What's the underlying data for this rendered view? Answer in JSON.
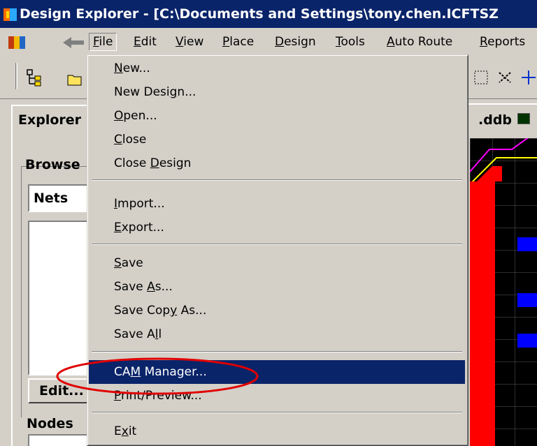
{
  "window": {
    "title": "Design Explorer - [C:\\Documents and Settings\\tony.chen.ICFTSZ"
  },
  "menubar": {
    "items": [
      {
        "pre": "",
        "ul": "F",
        "post": "ile"
      },
      {
        "pre": "",
        "ul": "E",
        "post": "dit"
      },
      {
        "pre": "",
        "ul": "V",
        "post": "iew"
      },
      {
        "pre": "",
        "ul": "P",
        "post": "lace"
      },
      {
        "pre": "",
        "ul": "D",
        "post": "esign"
      },
      {
        "pre": "",
        "ul": "T",
        "post": "ools"
      },
      {
        "pre": "",
        "ul": "A",
        "post": "uto Route"
      },
      {
        "pre": "",
        "ul": "R",
        "post": "eports"
      }
    ]
  },
  "tabs": {
    "explorer": "Explorer",
    "document": ".ddb"
  },
  "explorer_panel": {
    "browse_label": "Browse",
    "browse_select_value": "Nets",
    "edit_button": "Edit...",
    "nodes_label": "Nodes"
  },
  "file_menu": {
    "items": [
      {
        "pre": "",
        "ul": "N",
        "post": "ew..."
      },
      {
        "pre": "New Desi",
        "ul": "g",
        "post": "n..."
      },
      {
        "pre": "",
        "ul": "O",
        "post": "pen..."
      },
      {
        "pre": "",
        "ul": "C",
        "post": "lose"
      },
      {
        "pre": "Close ",
        "ul": "D",
        "post": "esign"
      },
      {
        "pre": "",
        "ul": "I",
        "post": "mport..."
      },
      {
        "pre": "",
        "ul": "E",
        "post": "xport..."
      },
      {
        "pre": "",
        "ul": "S",
        "post": "ave"
      },
      {
        "pre": "Save ",
        "ul": "A",
        "post": "s..."
      },
      {
        "pre": "Save Cop",
        "ul": "y",
        "post": " As..."
      },
      {
        "pre": "Save A",
        "ul": "l",
        "post": "l"
      },
      {
        "pre": "CA",
        "ul": "M",
        "post": " Manager..."
      },
      {
        "pre": "",
        "ul": "P",
        "post": "rint/Preview..."
      },
      {
        "pre": "E",
        "ul": "x",
        "post": "it"
      }
    ],
    "selected": "CAM Manager..."
  },
  "colors": {
    "titlebar": "#0a246a",
    "selection": "#0a246a",
    "highlight_ellipse": "#e00000",
    "pcb_background": "#000000",
    "pcb_track_red": "#ff0000",
    "pcb_pad_blue": "#0000ff",
    "pcb_track_yellow": "#ffff00",
    "pcb_track_magenta": "#ff00ff",
    "pcb_grid": "#5a5a5a"
  },
  "icons": [
    "app-icon",
    "dxp-logo-icon",
    "back-arrow-icon",
    "browse-tree-icon",
    "open-folder-icon",
    "zoom-area-icon",
    "cross-probe-icon",
    "document-icon"
  ]
}
